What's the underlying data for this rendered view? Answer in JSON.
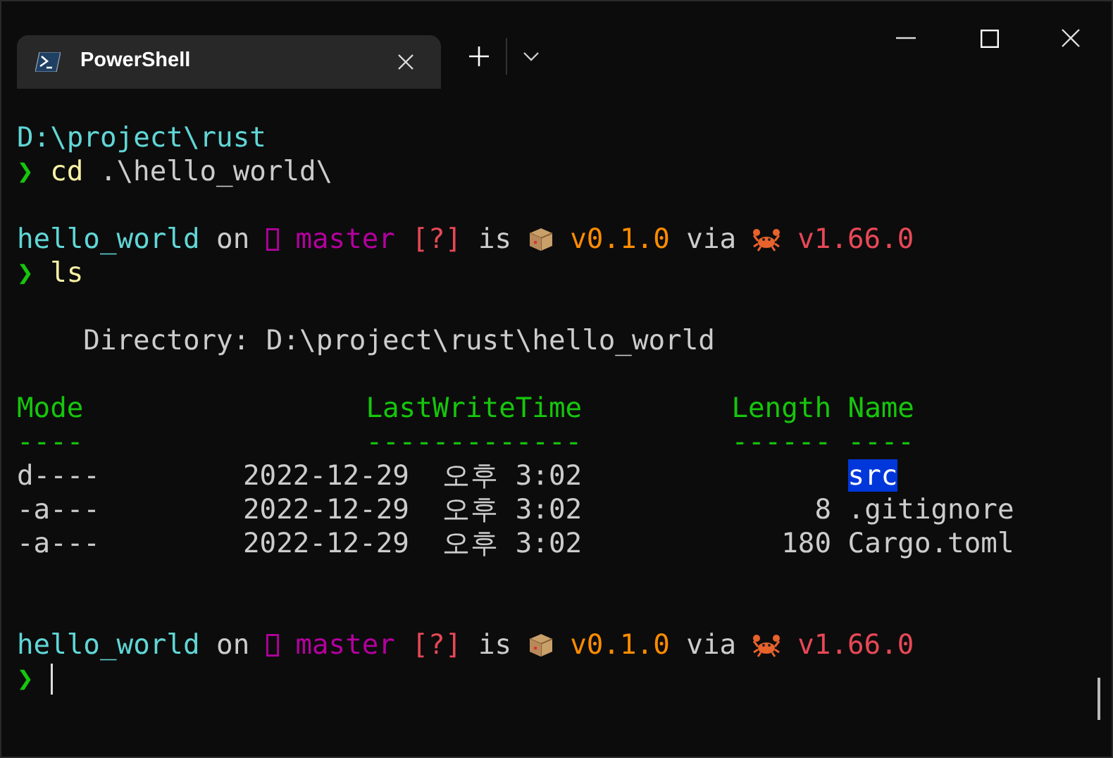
{
  "window": {
    "tabs": [
      {
        "title": "PowerShell",
        "selected": true
      }
    ]
  },
  "terminal": {
    "lines": [
      {
        "kind": "text",
        "segments": [
          {
            "kind": "text",
            "text": "D:\\project\\rust",
            "color": "#61d6d6"
          }
        ]
      },
      {
        "kind": "text",
        "segments": [
          {
            "kind": "text",
            "text": "❯",
            "color": "#16c60c"
          },
          {
            "kind": "text",
            "text": "cd",
            "color": "#f9f1a5"
          },
          {
            "kind": "text",
            "text": ".\\hello_world\\",
            "color": "#cccccc"
          }
        ]
      },
      {
        "kind": "blank"
      },
      {
        "kind": "text",
        "segments": [
          {
            "kind": "text",
            "text": "hello_world",
            "color": "#61d6d6"
          },
          {
            "kind": "text",
            "text": "on",
            "color": "#cccccc"
          },
          {
            "kind": "glyph-box"
          },
          {
            "kind": "text",
            "text": "master",
            "color": "#b4009e"
          },
          {
            "kind": "text",
            "text": "[?]",
            "color": "#e74856"
          },
          {
            "kind": "text",
            "text": "is",
            "color": "#cccccc"
          },
          {
            "kind": "package"
          },
          {
            "kind": "text",
            "text": "v0.1.0",
            "color": "#ff8c00"
          },
          {
            "kind": "text",
            "text": "via",
            "color": "#cccccc"
          },
          {
            "kind": "crab"
          },
          {
            "kind": "text",
            "text": "v1.66.0",
            "color": "#e74856"
          }
        ]
      },
      {
        "kind": "text",
        "segments": [
          {
            "kind": "text",
            "text": "❯",
            "color": "#16c60c"
          },
          {
            "kind": "text",
            "text": "ls",
            "color": "#f9f1a5"
          }
        ]
      },
      {
        "kind": "blank"
      },
      {
        "kind": "directory",
        "text": "Directory: D:\\project\\rust\\hello_world"
      },
      {
        "kind": "blank"
      },
      {
        "kind": "table",
        "columns": [
          {
            "label": "Mode",
            "rule": "----"
          },
          {
            "label": "LastWriteTime",
            "rule": "-------------"
          },
          {
            "label": "Length",
            "rule": "------"
          },
          {
            "label": "Name",
            "rule": "----"
          }
        ],
        "rows": [
          {
            "cells": [
              "d----",
              "2022-12-29  오후 3:02",
              "",
              "src"
            ],
            "selected": true
          },
          {
            "cells": [
              "-a---",
              "2022-12-29  오후 3:02",
              "8",
              ".gitignore"
            ],
            "selected": false
          },
          {
            "cells": [
              "-a---",
              "2022-12-29  오후 3:02",
              "180",
              "Cargo.toml"
            ],
            "selected": false
          }
        ]
      },
      {
        "kind": "blank"
      },
      {
        "kind": "blank"
      },
      {
        "kind": "text",
        "segments": [
          {
            "kind": "text",
            "text": "hello_world",
            "color": "#61d6d6"
          },
          {
            "kind": "text",
            "text": "on",
            "color": "#cccccc"
          },
          {
            "kind": "glyph-box"
          },
          {
            "kind": "text",
            "text": "master",
            "color": "#b4009e"
          },
          {
            "kind": "text",
            "text": "[?]",
            "color": "#e74856"
          },
          {
            "kind": "text",
            "text": "is",
            "color": "#cccccc"
          },
          {
            "kind": "package"
          },
          {
            "kind": "text",
            "text": "v0.1.0",
            "color": "#ff8c00"
          },
          {
            "kind": "text",
            "text": "via",
            "color": "#cccccc"
          },
          {
            "kind": "crab"
          },
          {
            "kind": "text",
            "text": "v1.66.0",
            "color": "#e74856"
          }
        ]
      },
      {
        "kind": "text",
        "segments": [
          {
            "kind": "text",
            "text": "❯",
            "color": "#16c60c"
          },
          {
            "kind": "cursor"
          }
        ]
      }
    ]
  }
}
